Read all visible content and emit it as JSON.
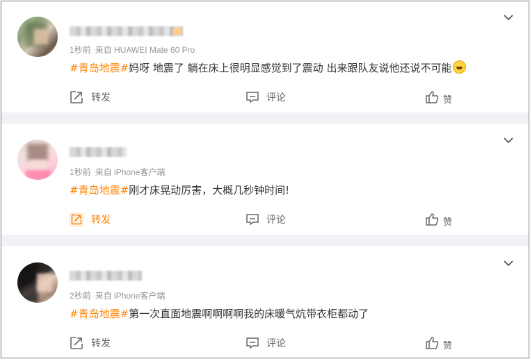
{
  "posts": [
    {
      "time": "1秒前",
      "source": "来自 HUAWEI Mate 60 Pro",
      "hashtag": "#青岛地震#",
      "text": "妈呀 地震了 躺在床上很明显感觉到了震动 出来跟队友说他还说不可能",
      "emoji": "laugh-cry-emoji",
      "actions": {
        "repost": "转发",
        "comment": "评论",
        "like": "赞"
      },
      "repost_active": false
    },
    {
      "time": "1秒前",
      "source": "来自 iPhone客户端",
      "hashtag": "#青岛地震#",
      "text": "刚才床晃动厉害，大概几秒钟时间!",
      "actions": {
        "repost": "转发",
        "comment": "评论",
        "like": "赞"
      },
      "repost_active": true
    },
    {
      "time": "2秒前",
      "source": "来自 iPhone客户端",
      "hashtag": "#青岛地震#",
      "text": "第一次直面地震啊啊啊啊我的床暖气炕带衣柜都动了",
      "actions": {
        "repost": "转发",
        "comment": "评论",
        "like": "赞"
      },
      "repost_active": false
    }
  ],
  "colors": {
    "accent": "#ff8200",
    "meta": "#939393",
    "text": "#333333",
    "divider": "#f1f2f5"
  },
  "icons": [
    "chevron-down-icon",
    "repost-icon",
    "comment-icon",
    "thumbs-up-icon"
  ]
}
